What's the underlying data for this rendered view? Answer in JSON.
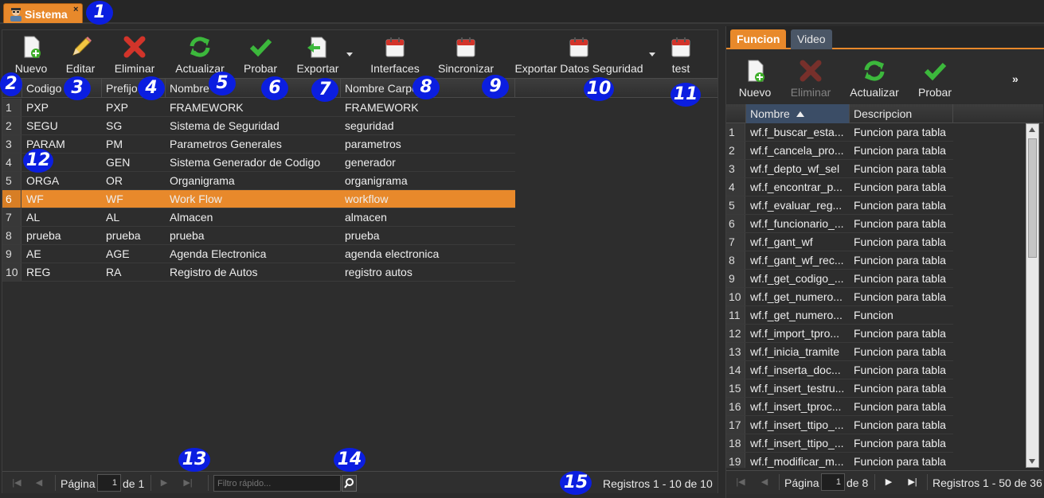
{
  "app_tab": {
    "label": "Sistema",
    "close": "×"
  },
  "badges": [
    "1",
    "2",
    "3",
    "4",
    "5",
    "6",
    "7",
    "8",
    "9",
    "10",
    "11",
    "12",
    "13",
    "14",
    "15"
  ],
  "toolbar": {
    "new_label": "Nuevo",
    "edit_label": "Editar",
    "delete_label": "Eliminar",
    "refresh_label": "Actualizar",
    "test_label": "Probar",
    "export_label": "Exportar",
    "interfaces_label": "Interfaces",
    "sync_label": "Sincronizar",
    "export_security_label": "Exportar Datos Seguridad",
    "test2_label": "test"
  },
  "grid": {
    "columns": [
      "Codigo",
      "Prefijo",
      "Nombre",
      "Nombre Carpeta"
    ],
    "rows": [
      {
        "n": "1",
        "codigo": "PXP",
        "prefijo": "PXP",
        "nombre": "FRAMEWORK",
        "carpeta": "FRAMEWORK"
      },
      {
        "n": "2",
        "codigo": "SEGU",
        "prefijo": "SG",
        "nombre": "Sistema de Seguridad",
        "carpeta": "seguridad"
      },
      {
        "n": "3",
        "codigo": "PARAM",
        "prefijo": "PM",
        "nombre": "Parametros Generales",
        "carpeta": "parametros"
      },
      {
        "n": "4",
        "codigo": "",
        "prefijo": "GEN",
        "nombre": "Sistema Generador de Codigo",
        "carpeta": "generador"
      },
      {
        "n": "5",
        "codigo": "ORGA",
        "prefijo": "OR",
        "nombre": "Organigrama",
        "carpeta": "organigrama"
      },
      {
        "n": "6",
        "codigo": "WF",
        "prefijo": "WF",
        "nombre": "Work Flow",
        "carpeta": "workflow"
      },
      {
        "n": "7",
        "codigo": "AL",
        "prefijo": "AL",
        "nombre": "Almacen",
        "carpeta": "almacen"
      },
      {
        "n": "8",
        "codigo": "prueba",
        "prefijo": "prueba",
        "nombre": "prueba",
        "carpeta": "prueba"
      },
      {
        "n": "9",
        "codigo": "AE",
        "prefijo": "AGE",
        "nombre": "Agenda Electronica",
        "carpeta": "agenda electronica"
      },
      {
        "n": "10",
        "codigo": "REG",
        "prefijo": "RA",
        "nombre": "Registro de Autos",
        "carpeta": "registro autos"
      }
    ],
    "selected_row": 6
  },
  "pager": {
    "page_label": "Página",
    "page_value": "1",
    "of_label": "de 1",
    "filter_placeholder": "Filtro rápido...",
    "records": "Registros 1 - 10 de 10"
  },
  "right": {
    "tabs": [
      "Funcion",
      "Video"
    ],
    "toolbar": {
      "new_label": "Nuevo",
      "delete_label": "Eliminar",
      "refresh_label": "Actualizar",
      "test_label": "Probar",
      "more": "»"
    },
    "columns": [
      "Nombre",
      "Descripcion"
    ],
    "rows": [
      {
        "n": "1",
        "nombre": "wf.f_buscar_esta...",
        "desc": "Funcion para tabla"
      },
      {
        "n": "2",
        "nombre": "wf.f_cancela_pro...",
        "desc": "Funcion para tabla"
      },
      {
        "n": "3",
        "nombre": "wf.f_depto_wf_sel",
        "desc": "Funcion para tabla"
      },
      {
        "n": "4",
        "nombre": "wf.f_encontrar_p...",
        "desc": "Funcion para tabla"
      },
      {
        "n": "5",
        "nombre": "wf.f_evaluar_reg...",
        "desc": "Funcion para tabla"
      },
      {
        "n": "6",
        "nombre": "wf.f_funcionario_...",
        "desc": "Funcion para tabla"
      },
      {
        "n": "7",
        "nombre": "wf.f_gant_wf",
        "desc": "Funcion para tabla"
      },
      {
        "n": "8",
        "nombre": "wf.f_gant_wf_rec...",
        "desc": "Funcion para tabla"
      },
      {
        "n": "9",
        "nombre": "wf.f_get_codigo_...",
        "desc": "Funcion para tabla"
      },
      {
        "n": "10",
        "nombre": "wf.f_get_numero...",
        "desc": "Funcion para tabla"
      },
      {
        "n": "11",
        "nombre": "wf.f_get_numero...",
        "desc": "Funcion"
      },
      {
        "n": "12",
        "nombre": "wf.f_import_tpro...",
        "desc": "Funcion para tabla"
      },
      {
        "n": "13",
        "nombre": "wf.f_inicia_tramite",
        "desc": "Funcion para tabla"
      },
      {
        "n": "14",
        "nombre": "wf.f_inserta_doc...",
        "desc": "Funcion para tabla"
      },
      {
        "n": "15",
        "nombre": "wf.f_insert_testru...",
        "desc": "Funcion para tabla"
      },
      {
        "n": "16",
        "nombre": "wf.f_insert_tproc...",
        "desc": "Funcion para tabla"
      },
      {
        "n": "17",
        "nombre": "wf.f_insert_ttipo_...",
        "desc": "Funcion para tabla"
      },
      {
        "n": "18",
        "nombre": "wf.f_insert_ttipo_...",
        "desc": "Funcion para tabla"
      },
      {
        "n": "19",
        "nombre": "wf.f_modificar_m...",
        "desc": "Funcion para tabla"
      }
    ],
    "pager": {
      "page_label": "Página",
      "page_value": "1",
      "of_label": "de 8",
      "records": "Registros 1 - 50 de 36"
    }
  },
  "colors": {
    "accent": "#e8892b",
    "badge": "#0b1ee0",
    "background": "#2d2d2d"
  }
}
